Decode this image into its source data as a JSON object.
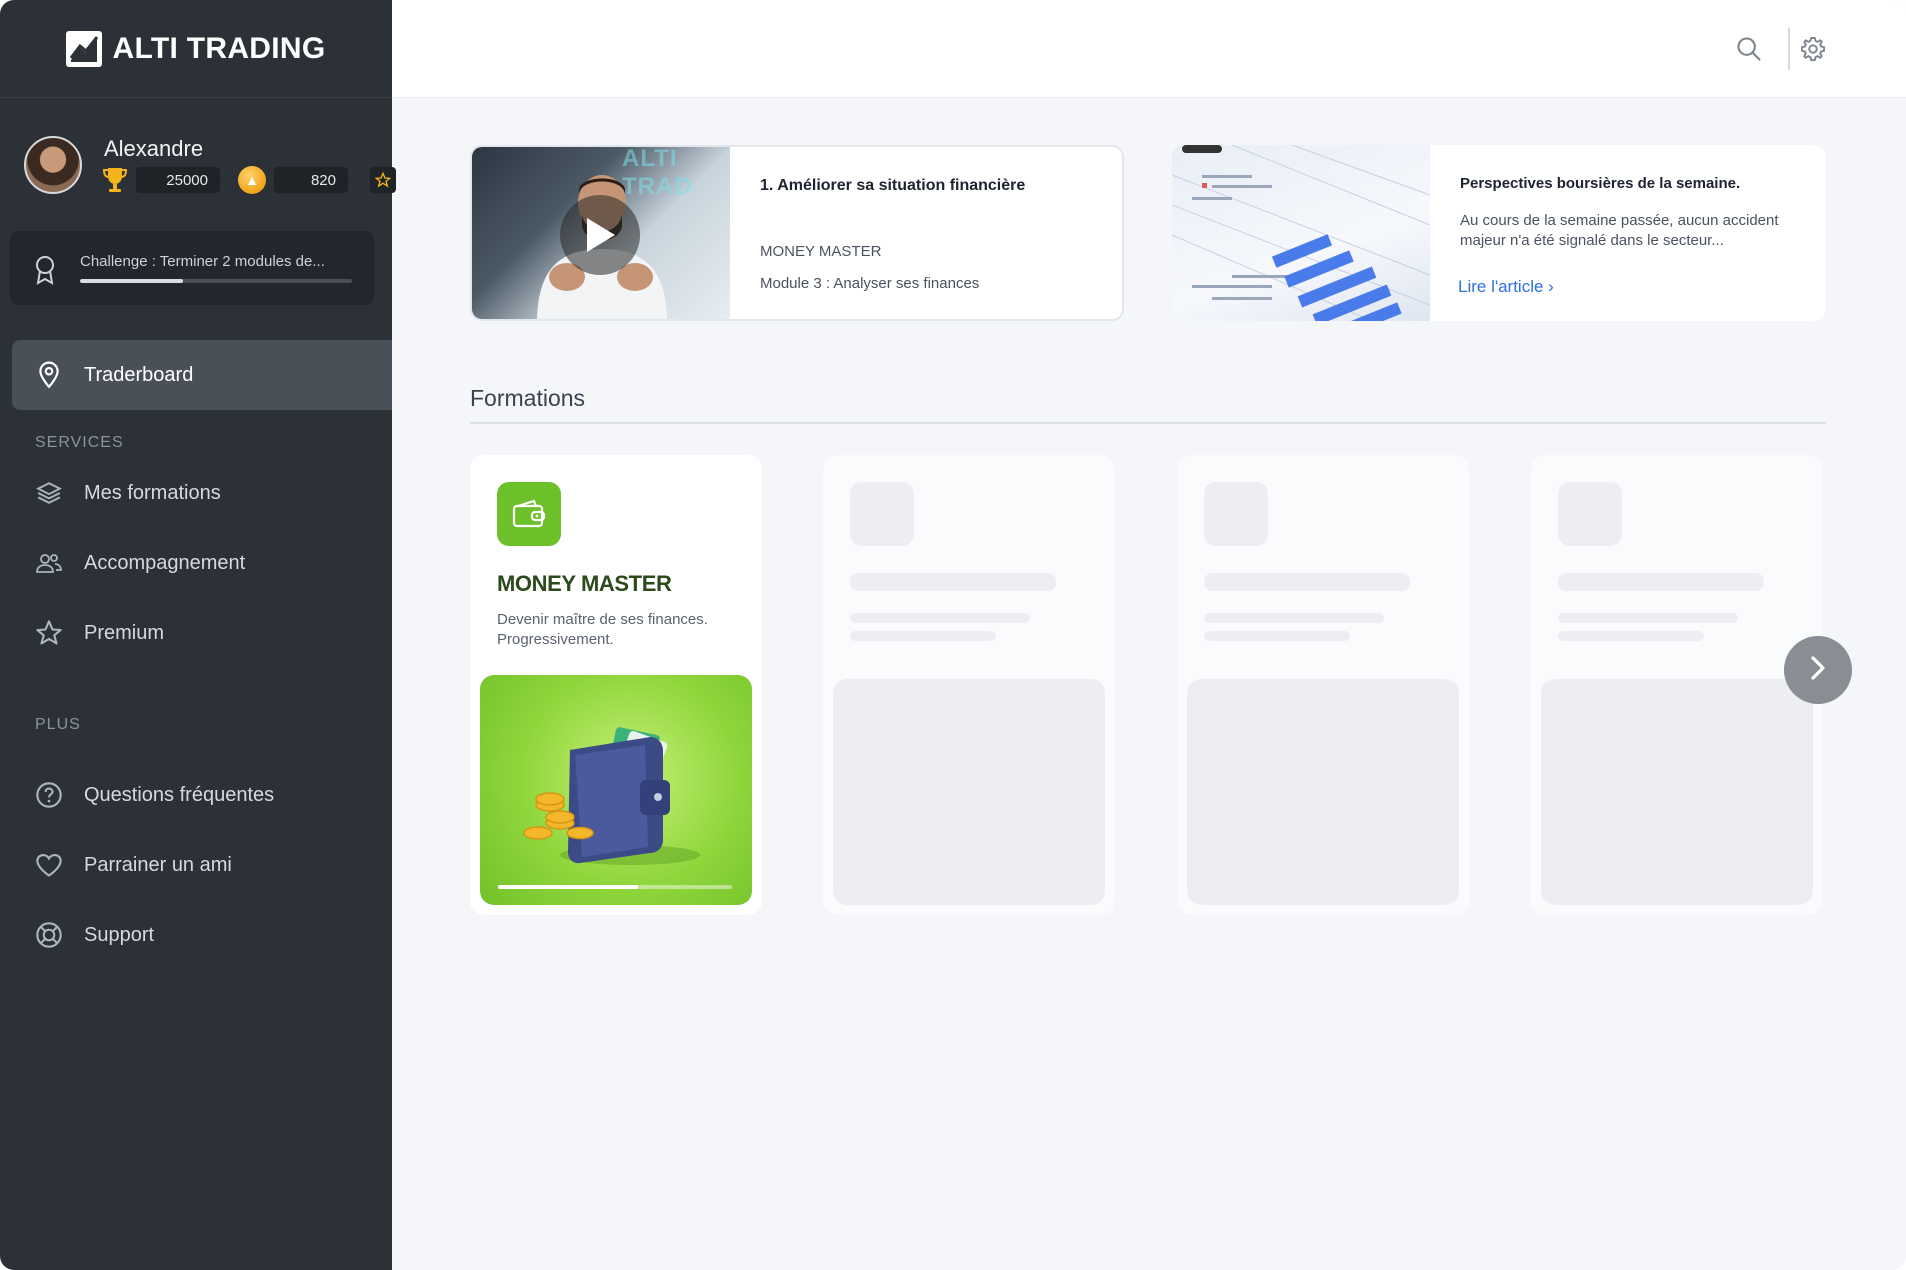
{
  "brand": {
    "name": "ALTI TRADING"
  },
  "user": {
    "name": "Alexandre",
    "trophies": "25000",
    "coins": "820"
  },
  "challenge": {
    "label": "Challenge : Terminer 2 modules de...",
    "progress": 0.38
  },
  "nav": {
    "active": {
      "label": "Traderboard",
      "icon": "map-pin-icon"
    },
    "services_title": "SERVICES",
    "services": [
      {
        "label": "Mes formations",
        "icon": "layers-icon"
      },
      {
        "label": "Accompagnement",
        "icon": "users-icon"
      },
      {
        "label": "Premium",
        "icon": "star-icon"
      }
    ],
    "plus_title": "PLUS",
    "plus": [
      {
        "label": "Questions fréquentes",
        "icon": "question-circle-icon"
      },
      {
        "label": "Parrainer un ami",
        "icon": "heart-icon"
      },
      {
        "label": "Support",
        "icon": "lifebuoy-icon"
      }
    ]
  },
  "header": {
    "icons": [
      "search-icon",
      "gear-icon"
    ]
  },
  "video_card": {
    "thumbnail_text": "ALTI TRAD",
    "title": "1. Améliorer sa situation financière",
    "course": "MONEY MASTER",
    "module": "Module 3 : Analyser ses finances"
  },
  "article_card": {
    "title": "Perspectives boursières de la semaine.",
    "excerpt": "Au cours de la semaine passée, aucun accident majeur n'a été signalé dans le secteur...",
    "link": "Lire l'article ›"
  },
  "formations": {
    "title": "Formations",
    "courses": [
      {
        "name": "MONEY MASTER",
        "description": "Devenir maître de ses finances. Progressivement.",
        "progress": 0.6,
        "icon": "wallet-icon",
        "accent": "#6cc12b"
      }
    ],
    "placeholders": 3
  },
  "colors": {
    "sidebar": "#2c3138",
    "link": "#2f6fe0",
    "course_green": "#6cc12b"
  }
}
